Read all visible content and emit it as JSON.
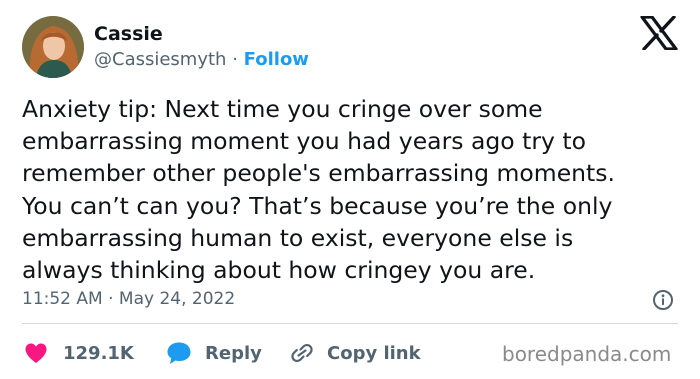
{
  "author": {
    "name": "Cassie",
    "handle": "@Cassiesmyth",
    "separator": "·",
    "follow_label": "Follow"
  },
  "tweet": {
    "text": "Anxiety tip: Next time you cringe over some\nembarrassing moment you had years ago try to\nremember other people's embarrassing moments.\nYou can’t can you? That’s because you’re the only\nembarrassing human to exist, everyone else is\nalways thinking about how cringey you are.",
    "timestamp": "11:52 AM · May 24, 2022"
  },
  "actions": {
    "like_count": "129.1K",
    "reply_label": "Reply",
    "copy_label": "Copy link"
  },
  "watermark": "boredpanda.com",
  "icons": {
    "logo": "x-logo-icon",
    "info": "info-icon",
    "like": "heart-icon",
    "reply": "speech-bubble-icon",
    "copy": "link-icon"
  },
  "colors": {
    "text": "#0f1419",
    "secondary": "#536471",
    "follow": "#1d9bf0",
    "like": "#f91880",
    "reply": "#1d9bf0",
    "divider": "#cfd9de",
    "watermark": "#8a8a8a"
  }
}
